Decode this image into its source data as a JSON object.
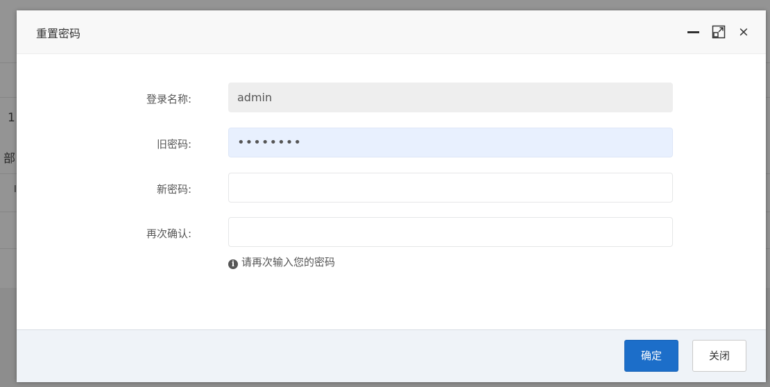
{
  "background": {
    "fragments": [
      "1",
      "部",
      "I"
    ]
  },
  "dialog": {
    "title": "重置密码",
    "controls": {
      "minimize_icon": "minimize-icon",
      "maximize_icon": "maximize-icon",
      "close_glyph": "×"
    },
    "form": {
      "login_name": {
        "label": "登录名称:",
        "value": "admin"
      },
      "old_password": {
        "label": "旧密码:",
        "value": "••••••••"
      },
      "new_password": {
        "label": "新密码:",
        "value": ""
      },
      "confirm_password": {
        "label": "再次确认:",
        "value": ""
      },
      "help_icon": "info-icon",
      "help_text": "请再次输入您的密码"
    },
    "buttons": {
      "ok": "确定",
      "close": "关闭"
    }
  },
  "colors": {
    "primary": "#1c6ec9",
    "overlay": "#8d8d8d",
    "autofill": "#e8f0fe",
    "footer": "#eff3f8"
  }
}
